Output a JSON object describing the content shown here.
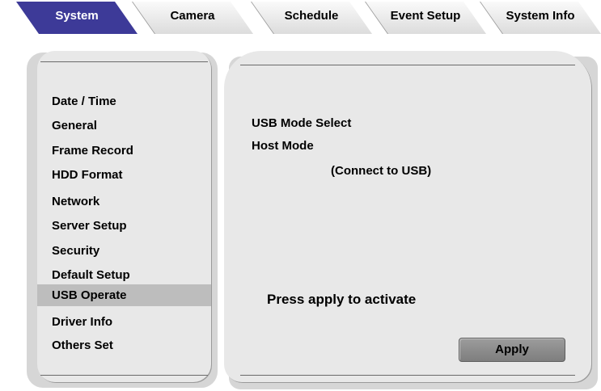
{
  "tabs": [
    {
      "label": "System",
      "active": true
    },
    {
      "label": "Camera",
      "active": false
    },
    {
      "label": "Schedule",
      "active": false
    },
    {
      "label": "Event Setup",
      "active": false
    },
    {
      "label": "System Info",
      "active": false
    }
  ],
  "menu": {
    "items": [
      {
        "label": "Date / Time"
      },
      {
        "label": "General"
      },
      {
        "label": "Frame Record"
      },
      {
        "label": "HDD Format"
      },
      {
        "label": "Network"
      },
      {
        "label": "Server Setup"
      },
      {
        "label": "Security"
      },
      {
        "label": "Default Setup"
      },
      {
        "label": "USB Operate",
        "selected": true
      },
      {
        "label": "Driver Info"
      },
      {
        "label": "Others Set"
      }
    ]
  },
  "content": {
    "mode_label": "USB Mode Select",
    "mode_value": "Host Mode",
    "mode_hint": "(Connect to USB)",
    "message": "Press apply to activate",
    "apply_label": "Apply"
  },
  "colors": {
    "active_tab": "#3d3a98",
    "panel": "#e8e8e8",
    "selected_item": "#bdbdbd"
  }
}
